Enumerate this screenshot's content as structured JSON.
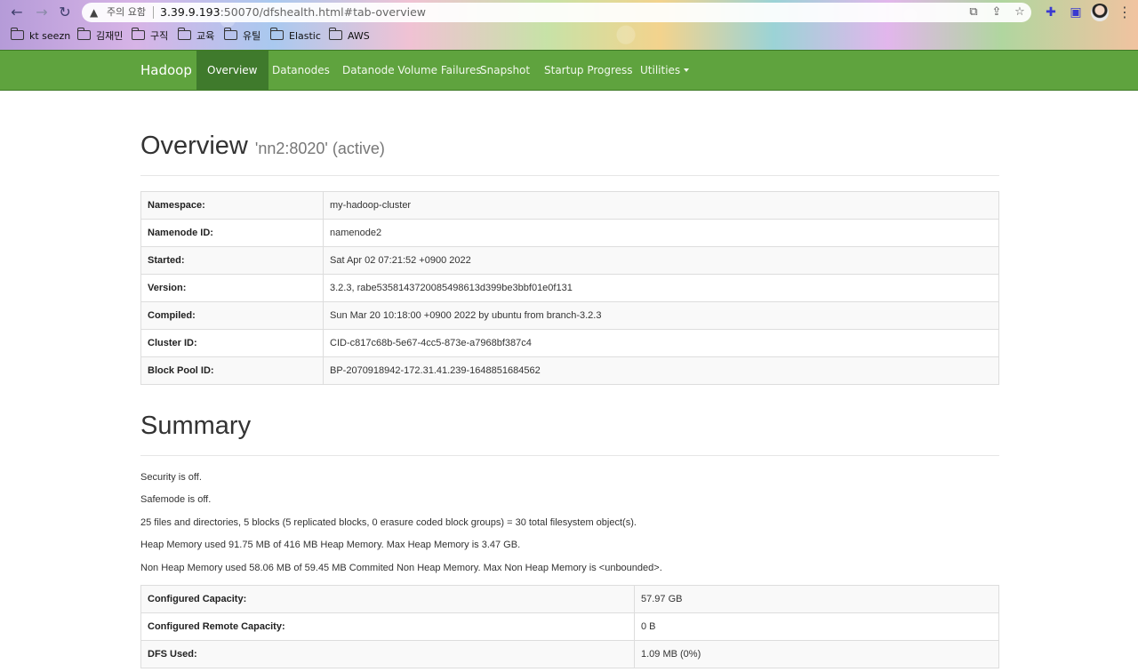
{
  "browser": {
    "not_secure_label": "주의 요함",
    "url_host": "3.39.9.193",
    "url_path": ":50070/dfshealth.html#tab-overview",
    "bookmarks": [
      "kt seezn",
      "김재민",
      "구직",
      "교육",
      "유틸",
      "Elastic",
      "AWS"
    ]
  },
  "navbar": {
    "brand": "Hadoop",
    "items": [
      "Overview",
      "Datanodes",
      "Datanode Volume Failures",
      "Snapshot",
      "Startup Progress",
      "Utilities"
    ],
    "active_index": 0
  },
  "overview": {
    "title": "Overview",
    "subtitle": "'nn2:8020' (active)",
    "rows": [
      {
        "key": "Namespace:",
        "value": "my-hadoop-cluster"
      },
      {
        "key": "Namenode ID:",
        "value": "namenode2"
      },
      {
        "key": "Started:",
        "value": "Sat Apr 02 07:21:52 +0900 2022"
      },
      {
        "key": "Version:",
        "value": "3.2.3, rabe5358143720085498613d399be3bbf01e0f131"
      },
      {
        "key": "Compiled:",
        "value": "Sun Mar 20 10:18:00 +0900 2022 by ubuntu from branch-3.2.3"
      },
      {
        "key": "Cluster ID:",
        "value": "CID-c817c68b-5e67-4cc5-873e-a7968bf387c4"
      },
      {
        "key": "Block Pool ID:",
        "value": "BP-2070918942-172.31.41.239-1648851684562"
      }
    ]
  },
  "summary": {
    "title": "Summary",
    "lines": [
      "Security is off.",
      "Safemode is off.",
      "25 files and directories, 5 blocks (5 replicated blocks, 0 erasure coded block groups) = 30 total filesystem object(s).",
      "Heap Memory used 91.75 MB of 416 MB Heap Memory. Max Heap Memory is 3.47 GB.",
      "Non Heap Memory used 58.06 MB of 59.45 MB Commited Non Heap Memory. Max Non Heap Memory is <unbounded>."
    ],
    "rows": [
      {
        "key": "Configured Capacity:",
        "value": "57.97 GB"
      },
      {
        "key": "Configured Remote Capacity:",
        "value": "0 B"
      },
      {
        "key": "DFS Used:",
        "value": "1.09 MB (0%)"
      }
    ]
  }
}
